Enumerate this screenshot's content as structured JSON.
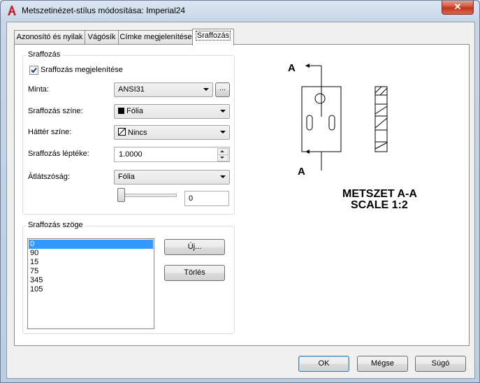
{
  "window": {
    "title": "Metszetinézet-stílus módosítása: Imperial24",
    "close_label": "✕"
  },
  "tabs": [
    {
      "label": "Azonosító és nyilak"
    },
    {
      "label": "Vágósík"
    },
    {
      "label": "Címke megjelenítése"
    },
    {
      "label": "Sraffozás"
    }
  ],
  "hatch_group": {
    "title": "Sraffozás",
    "show_checkbox": {
      "label": "Sraffozás megjelenítése",
      "checked": true
    },
    "pattern": {
      "label": "Minta:",
      "value": "ANSI31",
      "browse_label": "..."
    },
    "hatch_color": {
      "label": "Sraffozás színe:",
      "value": "Fólia",
      "swatch": "#000000"
    },
    "bg_color": {
      "label": "Háttér színe:",
      "value": "Nincs"
    },
    "scale": {
      "label": "Sraffozás léptéke:",
      "value": "1.0000"
    },
    "transparency": {
      "label": "Átlátszóság:",
      "value": "Fólia",
      "slider_value": "0"
    }
  },
  "angle_group": {
    "title": "Sraffozás szöge",
    "items": [
      "0",
      "90",
      "15",
      "75",
      "345",
      "105"
    ],
    "selected_index": 0,
    "new_button": "Új...",
    "delete_button": "Törlés"
  },
  "preview": {
    "label_top": "A",
    "label_bottom": "A",
    "caption_line1": "METSZET A-A",
    "caption_line2": "SCALE 1:2"
  },
  "footer": {
    "ok": "OK",
    "cancel": "Mégse",
    "help": "Súgó"
  },
  "colors": {
    "accent": "#3399ff",
    "app_icon": "#c4262e",
    "close_button": "#c23217"
  }
}
